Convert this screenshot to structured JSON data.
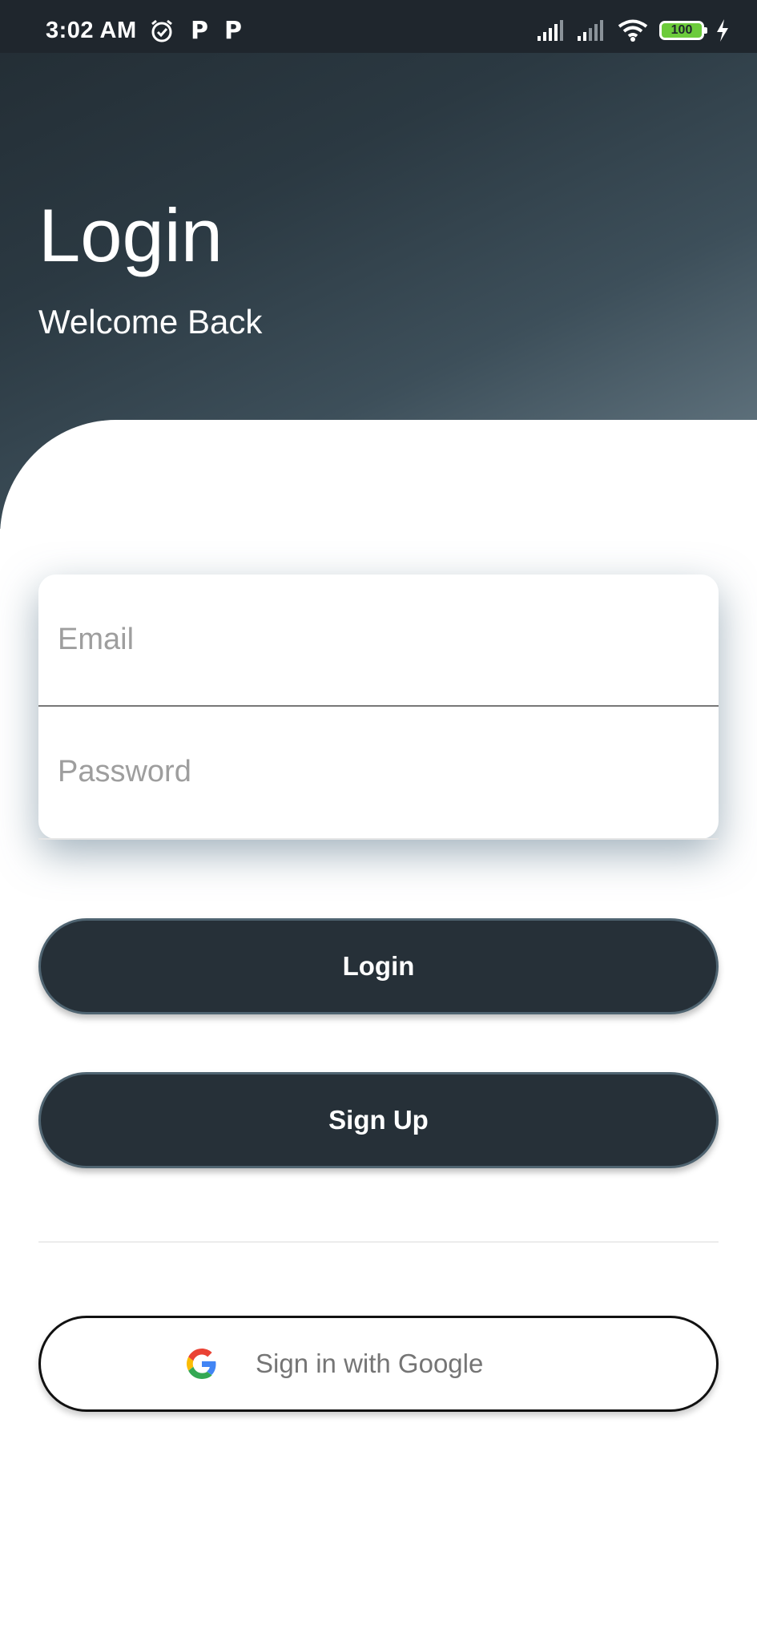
{
  "status_bar": {
    "time": "3:02 AM",
    "icons_left": [
      "alarm-icon",
      "parking-icon",
      "parking-icon"
    ],
    "p_glyph": "P",
    "battery_level": "100",
    "icons_right": [
      "signal-icon",
      "signal-icon",
      "wifi-icon",
      "battery-icon",
      "charging-icon"
    ]
  },
  "header": {
    "title": "Login",
    "subtitle": "Welcome Back"
  },
  "form": {
    "email_placeholder": "Email",
    "email_value": "",
    "password_placeholder": "Password",
    "password_value": ""
  },
  "buttons": {
    "login_label": "Login",
    "signup_label": "Sign Up",
    "google_label": "Sign in with Google"
  },
  "colors": {
    "header_dark": "#222c33",
    "header_light": "#6d808b",
    "button_dark": "#263038",
    "google_blue": "#4285F4",
    "google_red": "#EA4335",
    "google_yellow": "#FBBC05",
    "google_green": "#34A853"
  }
}
